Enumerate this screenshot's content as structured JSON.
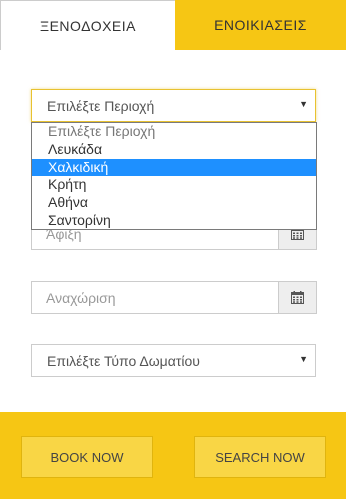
{
  "tabs": {
    "hotels": "ΞΕΝΟΔΟΧΕΙΑ",
    "rentals": "ΕΝΟΙΚΙΑΣΕΙΣ"
  },
  "region_select": {
    "selected": "Επιλέξτε Περιοχή",
    "options": [
      "Επιλέξτε Περιοχή",
      "Λευκάδα",
      "Χαλκιδική",
      "Κρήτη",
      "Αθήνα",
      "Σαντορίνη"
    ],
    "highlighted": "Χαλκιδική"
  },
  "arrival": {
    "placeholder": "Άφιξη"
  },
  "departure": {
    "placeholder": "Αναχώριση"
  },
  "room_select": {
    "selected": "Επιλέξτε Τύπο Δωματίου"
  },
  "buttons": {
    "book": "BOOK NOW",
    "search": "SEARCH NOW"
  },
  "colors": {
    "accent": "#f6c614",
    "highlight": "#1e90ff"
  },
  "icons": {
    "caret": "caret-down-icon",
    "calendar": "calendar-icon"
  }
}
